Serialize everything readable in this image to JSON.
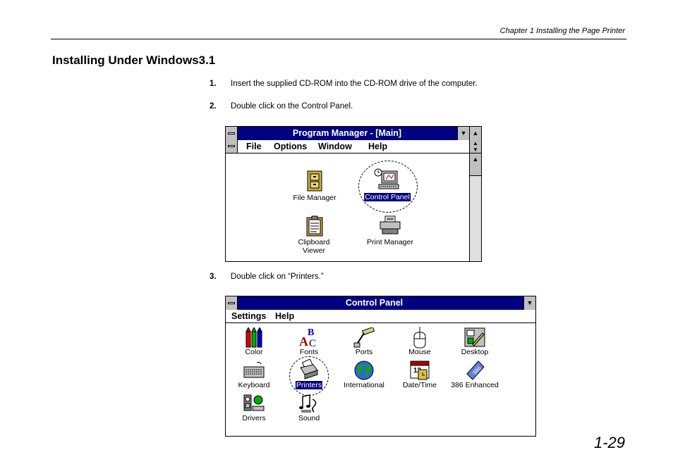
{
  "header": {
    "chapter": "Chapter 1  Installing the Page Printer"
  },
  "section_title": "Installing Under Windows3.1",
  "steps": [
    {
      "num": "1.",
      "text": "Insert the supplied CD-ROM into the CD-ROM drive of the computer."
    },
    {
      "num": "2.",
      "text": "Double click on the Control Panel."
    },
    {
      "num": "3.",
      "text": "Double click on “Printers.”"
    }
  ],
  "program_manager": {
    "title": "Program Manager - [Main]",
    "menu": [
      "File",
      "Options",
      "Window",
      "Help"
    ],
    "icons": [
      {
        "label": "File Manager",
        "icon": "file-cabinet-icon"
      },
      {
        "label": "Control Panel",
        "icon": "computer-icon",
        "selected": true
      },
      {
        "label": "Clipboard",
        "label2": "Viewer",
        "icon": "clipboard-icon"
      },
      {
        "label": "Print Manager",
        "icon": "printer-icon"
      }
    ]
  },
  "control_panel": {
    "title": "Control Panel",
    "menu": [
      "Settings",
      "Help"
    ],
    "icons": [
      {
        "label": "Color",
        "icon": "crayons-icon"
      },
      {
        "label": "Fonts",
        "icon": "fonts-icon"
      },
      {
        "label": "Ports",
        "icon": "plug-icon"
      },
      {
        "label": "Mouse",
        "icon": "mouse-icon"
      },
      {
        "label": "Desktop",
        "icon": "desktop-icon"
      },
      {
        "label": "Keyboard",
        "icon": "keyboard-icon"
      },
      {
        "label": "Printers",
        "icon": "printer-icon",
        "selected": true
      },
      {
        "label": "International",
        "icon": "globe-icon"
      },
      {
        "label": "Date/Time",
        "icon": "clock-calendar-icon"
      },
      {
        "label": "386 Enhanced",
        "icon": "chip-icon"
      },
      {
        "label": "Drivers",
        "icon": "drivers-icon"
      },
      {
        "label": "Sound",
        "icon": "music-note-icon"
      }
    ]
  },
  "page_number": "1-29"
}
